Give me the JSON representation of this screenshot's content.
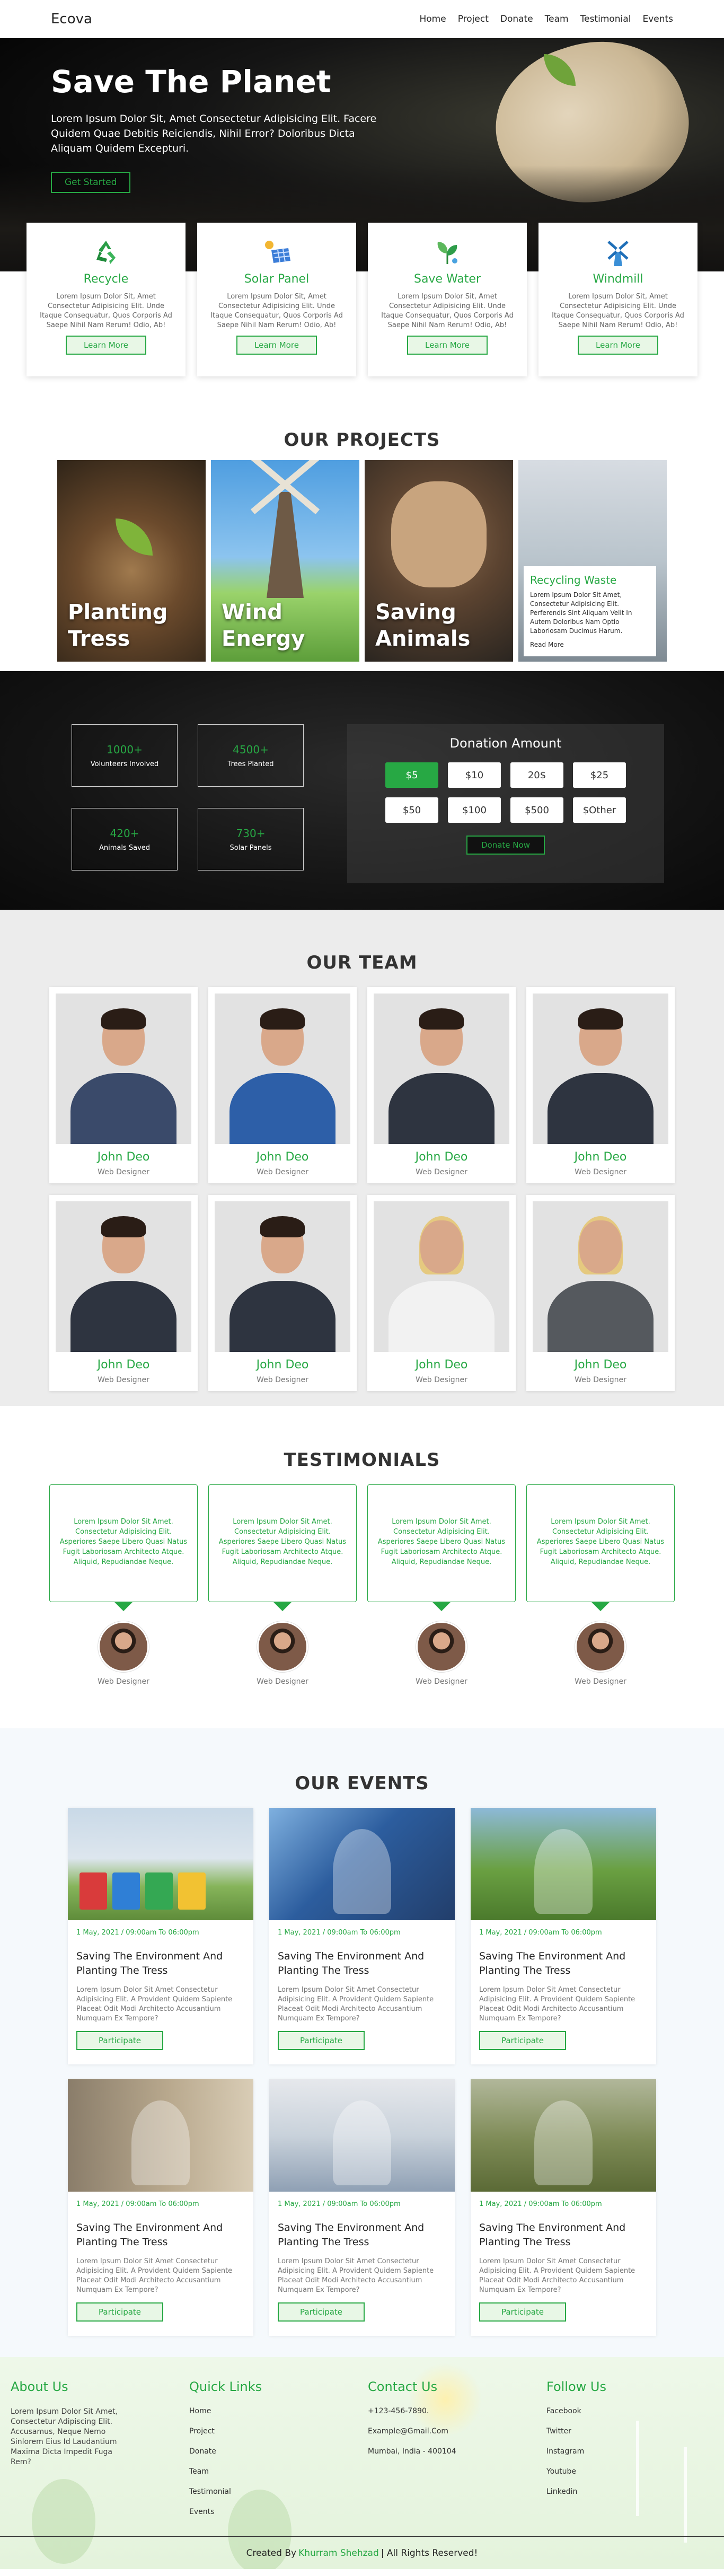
{
  "nav": {
    "brand": "Ecova",
    "links": [
      "Home",
      "Project",
      "Donate",
      "Team",
      "Testimonial",
      "Events"
    ]
  },
  "hero": {
    "title": "Save The Planet",
    "subtitle": "Lorem Ipsum Dolor Sit, Amet Consectetur Adipisicing Elit. Facere Quidem Quae Debitis Reiciendis, Nihil Error? Doloribus Dicta Aliquam Quidem Excepturi.",
    "cta": "Get Started"
  },
  "features": [
    {
      "title": "Recycle",
      "icon": "recycle-icon",
      "text": "Lorem Ipsum Dolor Sit, Amet Consectetur Adipisicing Elit. Unde Itaque Consequatur, Quos Corporis Ad Saepe Nihil Nam Rerum! Odio, Ab!",
      "button": "Learn More"
    },
    {
      "title": "Solar Panel",
      "icon": "solar-panel-icon",
      "text": "Lorem Ipsum Dolor Sit, Amet Consectetur Adipisicing Elit. Unde Itaque Consequatur, Quos Corporis Ad Saepe Nihil Nam Rerum! Odio, Ab!",
      "button": "Learn More"
    },
    {
      "title": "Save Water",
      "icon": "water-plant-icon",
      "text": "Lorem Ipsum Dolor Sit, Amet Consectetur Adipisicing Elit. Unde Itaque Consequatur, Quos Corporis Ad Saepe Nihil Nam Rerum! Odio, Ab!",
      "button": "Learn More"
    },
    {
      "title": "Windmill",
      "icon": "windmill-icon",
      "text": "Lorem Ipsum Dolor Sit, Amet Consectetur Adipisicing Elit. Unde Itaque Consequatur, Quos Corporis Ad Saepe Nihil Nam Rerum! Odio, Ab!",
      "button": "Learn More"
    }
  ],
  "projects": {
    "title": "OUR PROJECTS",
    "items": [
      {
        "label_line1": "Planting",
        "label_line2": "Tress"
      },
      {
        "label_line1": "Wind Energy",
        "label_line2": ""
      },
      {
        "label_line1": "Saving",
        "label_line2": "Animals"
      }
    ],
    "card": {
      "title": "Recycling Waste",
      "text": "Lorem Ipsum Dolor Sit Amet, Consectetur Adipisicing Elit. Perferendis Sint Aliquam Velit In Autem Doloribus Nam Optio Laboriosam Ducimus Harum.",
      "link": "Read More"
    }
  },
  "stats": [
    {
      "num": "1000+",
      "label": "Volunteers Involved"
    },
    {
      "num": "4500+",
      "label": "Trees Planted"
    },
    {
      "num": "420+",
      "label": "Animals Saved"
    },
    {
      "num": "730+",
      "label": "Solar Panels"
    }
  ],
  "donation": {
    "title": "Donation Amount",
    "amounts": [
      "$5",
      "$10",
      "20$",
      "$25",
      "$50",
      "$100",
      "$500",
      "$Other"
    ],
    "selected": "$5",
    "button": "Donate Now"
  },
  "team": {
    "title": "OUR TEAM",
    "members": [
      {
        "name": "John Deo",
        "role": "Web Designer"
      },
      {
        "name": "John Deo",
        "role": "Web Designer"
      },
      {
        "name": "John Deo",
        "role": "Web Designer"
      },
      {
        "name": "John Deo",
        "role": "Web Designer"
      },
      {
        "name": "John Deo",
        "role": "Web Designer"
      },
      {
        "name": "John Deo",
        "role": "Web Designer"
      },
      {
        "name": "John Deo",
        "role": "Web Designer"
      },
      {
        "name": "John Deo",
        "role": "Web Designer"
      }
    ]
  },
  "testimonials": {
    "title": "TESTIMONIALS",
    "items": [
      {
        "text": "Lorem Ipsum Dolor Sit Amet. Consectetur Adipisicing Elit. Asperiores Saepe Libero Quasi Natus Fugit Laboriosam Architecto Atque. Aliquid, Repudiandae Neque.",
        "role": "Web Designer"
      },
      {
        "text": "Lorem Ipsum Dolor Sit Amet. Consectetur Adipisicing Elit. Asperiores Saepe Libero Quasi Natus Fugit Laboriosam Architecto Atque. Aliquid, Repudiandae Neque.",
        "role": "Web Designer"
      },
      {
        "text": "Lorem Ipsum Dolor Sit Amet. Consectetur Adipisicing Elit. Asperiores Saepe Libero Quasi Natus Fugit Laboriosam Architecto Atque. Aliquid, Repudiandae Neque.",
        "role": "Web Designer"
      },
      {
        "text": "Lorem Ipsum Dolor Sit Amet. Consectetur Adipisicing Elit. Asperiores Saepe Libero Quasi Natus Fugit Laboriosam Architecto Atque. Aliquid, Repudiandae Neque.",
        "role": "Web Designer"
      }
    ]
  },
  "events": {
    "title": "OUR EVENTS",
    "items": [
      {
        "meta": "1 May, 2021 / 09:00am To 06:00pm",
        "title": "Saving The Environment And Planting The Tress",
        "text": "Lorem Ipsum Dolor Sit Amet Consectetur Adipisicing Elit. A Provident Quidem Sapiente Placeat Odit Modi Architecto Accusantium Numquam Ex Tempore?",
        "button": "Participate"
      },
      {
        "meta": "1 May, 2021 / 09:00am To 06:00pm",
        "title": "Saving The Environment And Planting The Tress",
        "text": "Lorem Ipsum Dolor Sit Amet Consectetur Adipisicing Elit. A Provident Quidem Sapiente Placeat Odit Modi Architecto Accusantium Numquam Ex Tempore?",
        "button": "Participate"
      },
      {
        "meta": "1 May, 2021 / 09:00am To 06:00pm",
        "title": "Saving The Environment And Planting The Tress",
        "text": "Lorem Ipsum Dolor Sit Amet Consectetur Adipisicing Elit. A Provident Quidem Sapiente Placeat Odit Modi Architecto Accusantium Numquam Ex Tempore?",
        "button": "Participate"
      },
      {
        "meta": "1 May, 2021 / 09:00am To 06:00pm",
        "title": "Saving The Environment And Planting The Tress",
        "text": "Lorem Ipsum Dolor Sit Amet Consectetur Adipisicing Elit. A Provident Quidem Sapiente Placeat Odit Modi Architecto Accusantium Numquam Ex Tempore?",
        "button": "Participate"
      },
      {
        "meta": "1 May, 2021 / 09:00am To 06:00pm",
        "title": "Saving The Environment And Planting The Tress",
        "text": "Lorem Ipsum Dolor Sit Amet Consectetur Adipisicing Elit. A Provident Quidem Sapiente Placeat Odit Modi Architecto Accusantium Numquam Ex Tempore?",
        "button": "Participate"
      },
      {
        "meta": "1 May, 2021 / 09:00am To 06:00pm",
        "title": "Saving The Environment And Planting The Tress",
        "text": "Lorem Ipsum Dolor Sit Amet Consectetur Adipisicing Elit. A Provident Quidem Sapiente Placeat Odit Modi Architecto Accusantium Numquam Ex Tempore?",
        "button": "Participate"
      }
    ]
  },
  "footer": {
    "about_title": "About Us",
    "about_text": "Lorem Ipsum Dolor Sit Amet, Consectetur Adipiscing Elit. Accusamus, Neque Nemo Sinlorem Eius Id Laudantium Maxima Dicta Impedit Fuga Rem?",
    "quick_title": "Quick Links",
    "quick_links": [
      "Home",
      "Project",
      "Donate",
      "Team",
      "Testimonial",
      "Events"
    ],
    "contact_title": "Contact Us",
    "contact": [
      "+123-456-7890.",
      "Example@Gmail.Com",
      "Mumbai, India - 400104"
    ],
    "follow_title": "Follow Us",
    "follow": [
      "Facebook",
      "Twitter",
      "Instagram",
      "Youtube",
      "Linkedin"
    ],
    "copyright_prefix": "Created By",
    "copyright_author": "Khurram Shehzad",
    "copyright_suffix": "| All Rights Reserved!"
  },
  "colors": {
    "accent": "#27a844",
    "dark": "#111111"
  }
}
